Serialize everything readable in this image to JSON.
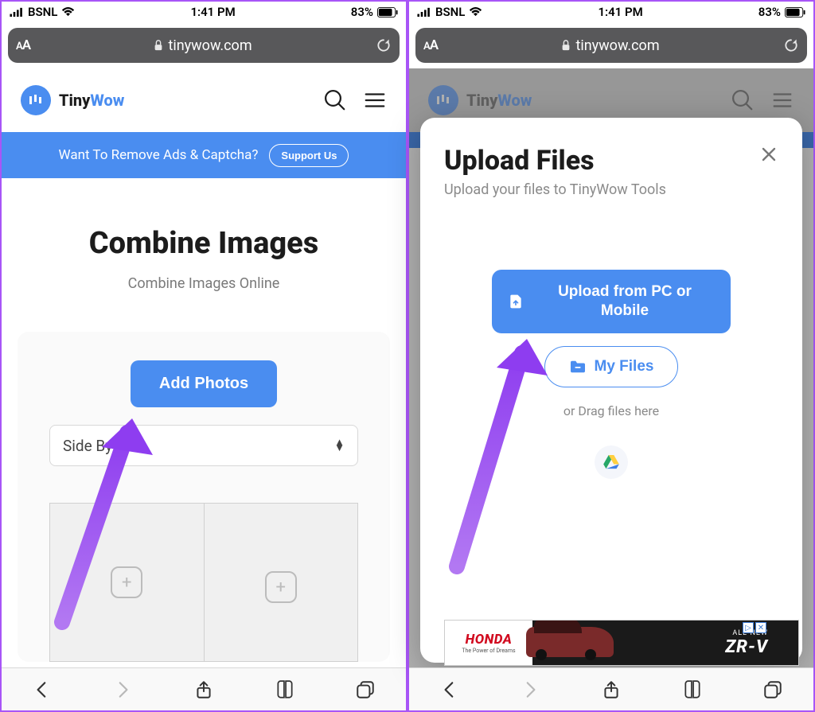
{
  "status": {
    "carrier": "BSNL",
    "time": "1:41 PM",
    "battery_text": "83%"
  },
  "safari": {
    "domain": "tinywow.com"
  },
  "brand": {
    "part1": "Tiny",
    "part2": "Wow"
  },
  "promo": {
    "text": "Want To Remove Ads & Captcha?",
    "cta": "Support Us"
  },
  "left": {
    "title": "Combine Images",
    "subtitle": "Combine Images Online",
    "add_btn": "Add Photos",
    "select_value": "Side By Side"
  },
  "modal": {
    "title": "Upload Files",
    "subtitle": "Upload your files to TinyWow Tools",
    "upload_btn": "Upload from PC or Mobile",
    "myfiles_btn": "My Files",
    "drag_text": "or Drag files here"
  },
  "ad": {
    "honda": "HONDA",
    "tagline": "The Power of Dreams",
    "allnew": "ALL-NEW",
    "model": "ZR-V"
  }
}
